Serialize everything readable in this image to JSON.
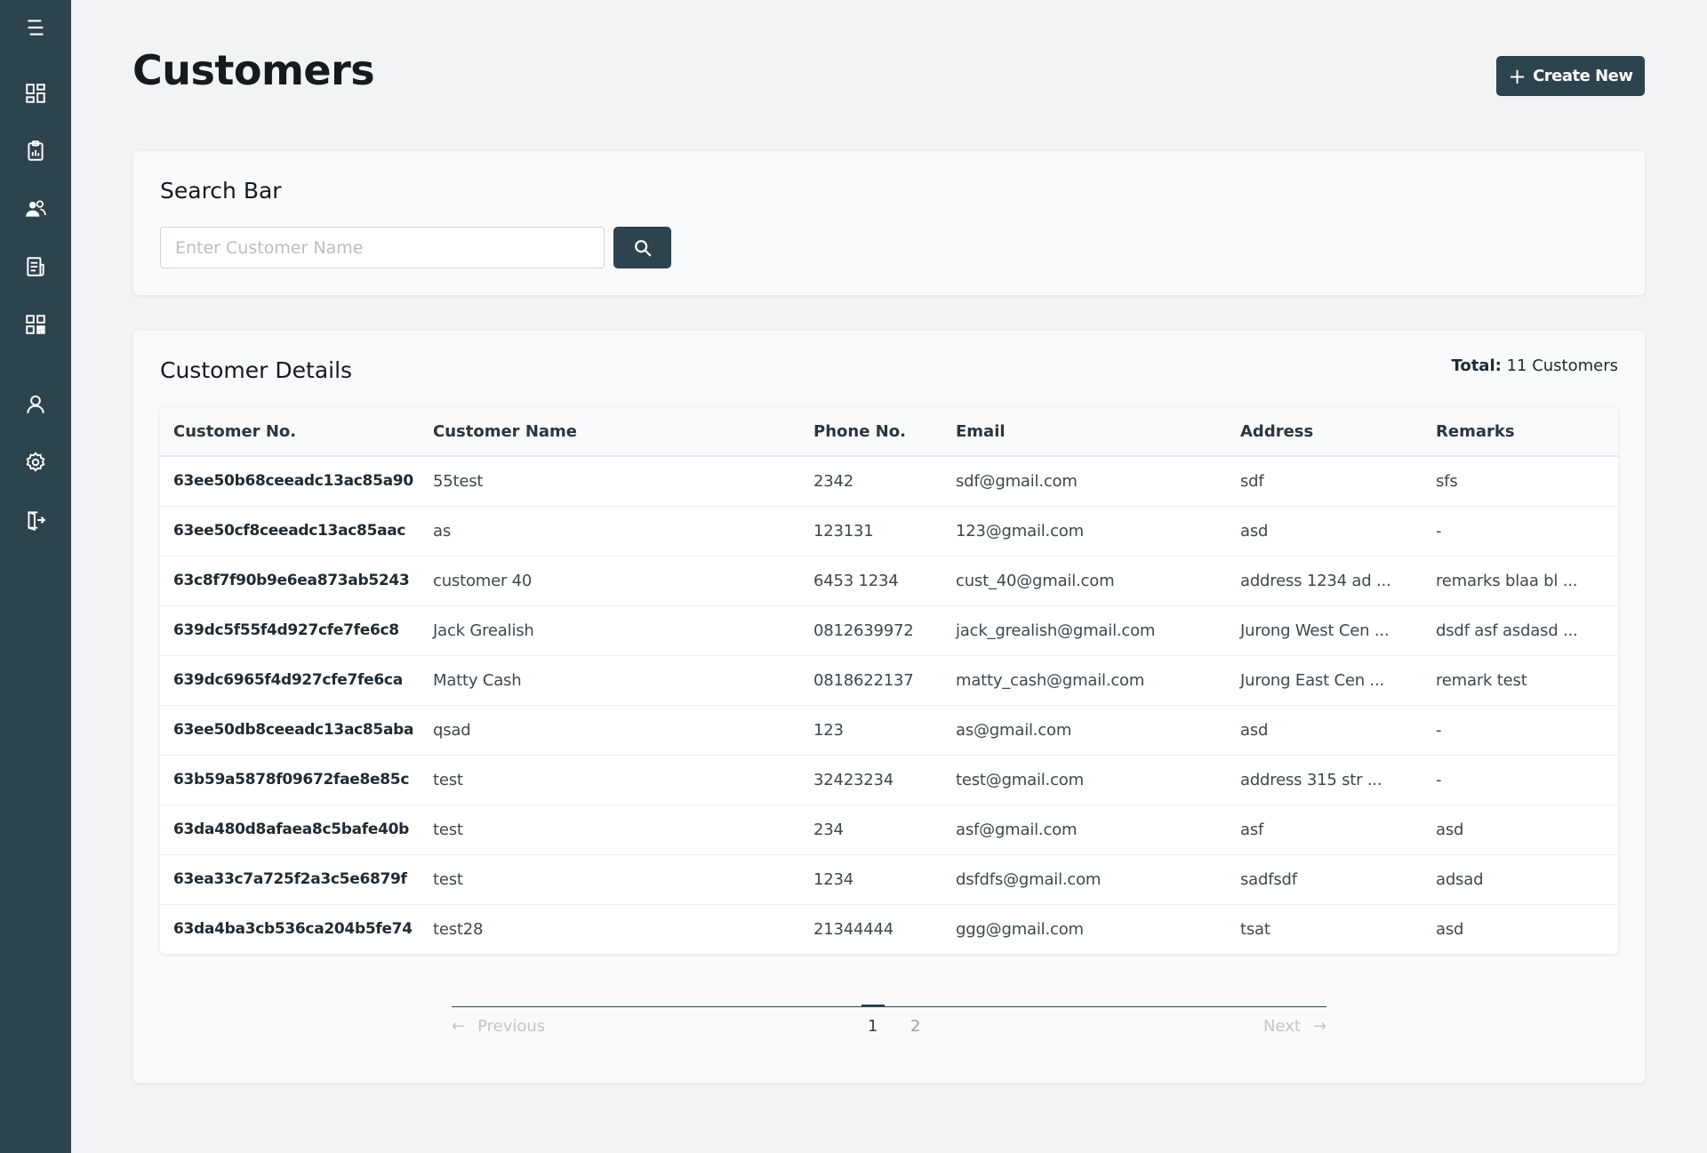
{
  "page": {
    "title": "Customers",
    "create_button": "Create New"
  },
  "sidebar": {
    "items": [
      {
        "icon": "menu-icon"
      },
      {
        "icon": "dashboard-icon"
      },
      {
        "icon": "clipboard-chart-icon"
      },
      {
        "icon": "customers-icon"
      },
      {
        "icon": "document-list-icon"
      },
      {
        "icon": "qr-code-icon"
      },
      {
        "icon": "user-icon"
      },
      {
        "icon": "settings-icon"
      },
      {
        "icon": "logout-icon"
      }
    ]
  },
  "search": {
    "title": "Search Bar",
    "placeholder": "Enter Customer Name",
    "value": ""
  },
  "details": {
    "title": "Customer Details",
    "total_label": "Total:",
    "total_value": "11 Customers",
    "columns": [
      "Customer No.",
      "Customer Name",
      "Phone No.",
      "Email",
      "Address",
      "Remarks"
    ],
    "rows": [
      [
        "63ee50b68ceeadc13ac85a90",
        "55test",
        "2342",
        "sdf@gmail.com",
        "sdf",
        "sfs"
      ],
      [
        "63ee50cf8ceeadc13ac85aac",
        "as",
        "123131",
        "123@gmail.com",
        "asd",
        "-"
      ],
      [
        "63c8f7f90b9e6ea873ab5243",
        "customer 40",
        "6453 1234",
        "cust_40@gmail.com",
        "address 1234 ad ...",
        "remarks blaa bl ..."
      ],
      [
        "639dc5f55f4d927cfe7fe6c8",
        "Jack Grealish",
        "0812639972",
        "jack_grealish@gmail.com",
        "Jurong West Cen ...",
        "dsdf asf asdasd ..."
      ],
      [
        "639dc6965f4d927cfe7fe6ca",
        "Matty Cash",
        "0818622137",
        "matty_cash@gmail.com",
        "Jurong East Cen ...",
        "remark test"
      ],
      [
        "63ee50db8ceeadc13ac85aba",
        "qsad",
        "123",
        "as@gmail.com",
        "asd",
        "-"
      ],
      [
        "63b59a5878f09672fae8e85c",
        "test",
        "32423234",
        "test@gmail.com",
        "address 315 str ...",
        "-"
      ],
      [
        "63da480d8afaea8c5bafe40b",
        "test",
        "234",
        "asf@gmail.com",
        "asf",
        "asd"
      ],
      [
        "63ea33c7a725f2a3c5e6879f",
        "test",
        "1234",
        "dsfdfs@gmail.com",
        "sadfsdf",
        "adsad"
      ],
      [
        "63da4ba3cb536ca204b5fe74",
        "test28",
        "21344444",
        "ggg@gmail.com",
        "tsat",
        "asd"
      ]
    ]
  },
  "pagination": {
    "previous": "Previous",
    "next": "Next",
    "pages": [
      "1",
      "2"
    ],
    "current": "1"
  },
  "colors": {
    "accent": "#2d434e",
    "background": "#f1f3f5"
  }
}
